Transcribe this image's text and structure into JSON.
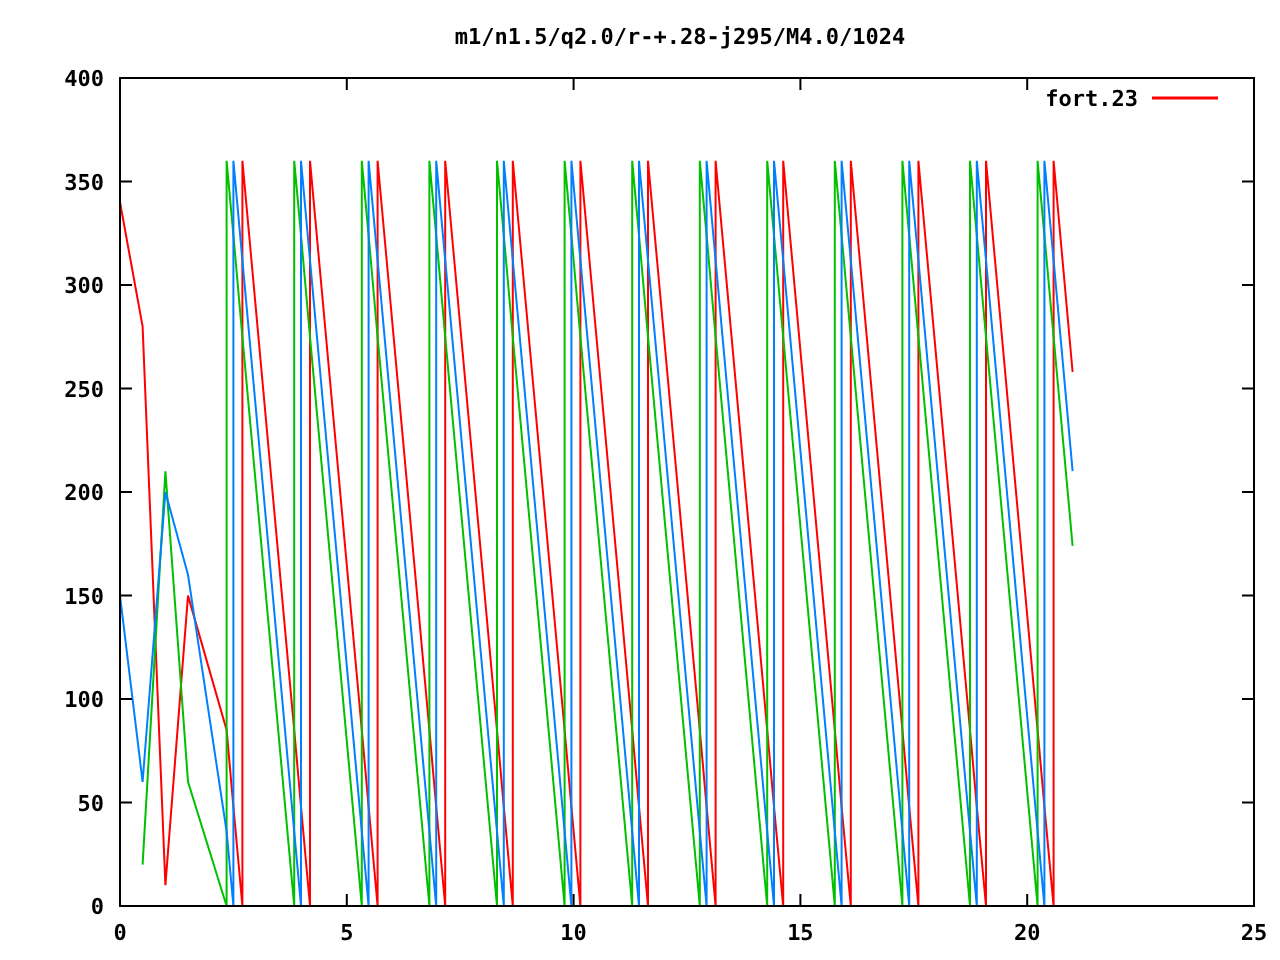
{
  "chart_data": {
    "type": "line",
    "title": "m1/n1.5/q2.0/r-+.28-j295/M4.0/1024",
    "xlim": [
      0,
      25
    ],
    "ylim": [
      0,
      400
    ],
    "xticks": [
      0,
      5,
      10,
      15,
      20,
      25
    ],
    "yticks": [
      0,
      50,
      100,
      150,
      200,
      250,
      300,
      350,
      400
    ],
    "x": [
      0,
      0.5,
      1,
      1.5,
      2.35,
      2.35,
      2.5,
      2.5,
      2.7,
      2.7,
      3.84,
      3.84,
      3.99,
      3.99,
      4.19,
      4.19,
      5.33,
      5.33,
      5.48,
      5.48,
      5.68,
      5.68,
      6.82,
      6.82,
      6.97,
      6.97,
      7.17,
      7.17,
      8.31,
      8.31,
      8.46,
      8.46,
      8.66,
      8.66,
      9.8,
      9.8,
      9.95,
      9.95,
      10.15,
      10.15,
      11.29,
      11.29,
      11.44,
      11.44,
      11.64,
      11.64,
      12.78,
      12.78,
      12.93,
      12.93,
      13.13,
      13.13,
      14.27,
      14.27,
      14.42,
      14.42,
      14.62,
      14.62,
      15.76,
      15.76,
      15.91,
      15.91,
      16.11,
      16.11,
      17.25,
      17.25,
      17.4,
      17.4,
      17.6,
      17.6,
      18.74,
      18.74,
      18.89,
      18.89,
      19.09,
      19.09,
      20.23,
      20.23,
      20.38,
      20.38,
      20.58,
      20.58,
      21
    ],
    "series": [
      {
        "name": "fort.23",
        "color": "#ff0000",
        "values": [
          340,
          280,
          10,
          150,
          85,
          85,
          48,
          48,
          0,
          360,
          85,
          85,
          48,
          48,
          0,
          360,
          85,
          85,
          48,
          48,
          0,
          360,
          85,
          85,
          48,
          48,
          0,
          360,
          85,
          85,
          48,
          48,
          0,
          360,
          85,
          85,
          48,
          48,
          0,
          360,
          85,
          85,
          48,
          48,
          0,
          360,
          85,
          85,
          48,
          48,
          0,
          360,
          85,
          85,
          48,
          48,
          0,
          360,
          85,
          85,
          48,
          48,
          0,
          360,
          85,
          85,
          48,
          48,
          0,
          360,
          85,
          85,
          48,
          48,
          0,
          360,
          85,
          85,
          48,
          48,
          0,
          360,
          258
        ]
      },
      {
        "color": "#00c000",
        "values": [
          null,
          20,
          210,
          60,
          0,
          360,
          324,
          324,
          275,
          275,
          0,
          360,
          324,
          324,
          275,
          275,
          0,
          360,
          324,
          324,
          275,
          275,
          0,
          360,
          324,
          324,
          275,
          275,
          0,
          360,
          324,
          324,
          275,
          275,
          0,
          360,
          324,
          324,
          275,
          275,
          0,
          360,
          324,
          324,
          275,
          275,
          0,
          360,
          324,
          324,
          275,
          275,
          0,
          360,
          324,
          324,
          275,
          275,
          0,
          360,
          324,
          324,
          275,
          275,
          0,
          360,
          324,
          324,
          275,
          275,
          0,
          360,
          324,
          324,
          275,
          275,
          0,
          360,
          324,
          324,
          275,
          275,
          174
        ]
      },
      {
        "color": "#0080ff",
        "values": [
          150,
          60,
          200,
          160,
          36,
          36,
          0,
          360,
          312,
          312,
          36,
          36,
          0,
          360,
          312,
          312,
          36,
          36,
          0,
          360,
          312,
          312,
          36,
          36,
          0,
          360,
          312,
          312,
          36,
          36,
          0,
          360,
          312,
          312,
          36,
          36,
          0,
          360,
          312,
          312,
          36,
          36,
          0,
          360,
          312,
          312,
          36,
          36,
          0,
          360,
          312,
          312,
          36,
          36,
          0,
          360,
          312,
          312,
          36,
          36,
          0,
          360,
          312,
          312,
          36,
          36,
          0,
          360,
          312,
          312,
          36,
          36,
          0,
          360,
          312,
          312,
          36,
          36,
          0,
          360,
          312,
          312,
          210
        ]
      }
    ]
  }
}
